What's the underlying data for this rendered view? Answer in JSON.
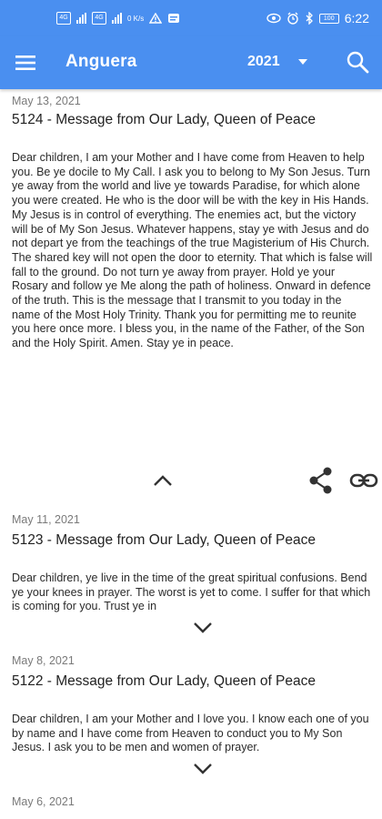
{
  "status_bar": {
    "sim1": "4G",
    "sim2": "4G",
    "net_speed": "0 K/s",
    "battery": "100",
    "time": "6:22"
  },
  "app_bar": {
    "title": "Anguera",
    "year": "2021",
    "menu_icon": "hamburger-menu-icon",
    "dropdown_icon": "triangle-down-icon",
    "search_icon": "search-icon"
  },
  "posts": [
    {
      "date": "May 13, 2021",
      "title": "5124 - Message from Our Lady, Queen of Peace",
      "body": "Dear children, I am your Mother and I have come from Heaven to help you. Be ye docile to My Call. I ask you to belong to My Son Jesus. Turn ye away from the world and live ye towards Paradise, for which alone you were created. He who is the door will be with the key in His Hands. My Jesus is in control of everything. The enemies act, but the victory will be of My Son Jesus. Whatever happens, stay ye with Jesus and do not depart ye from the teachings of the true Magisterium of His Church. The shared key will not open the door to eternity. That which is false will fall to the ground. Do not turn ye away from prayer. Hold ye your Rosary and follow ye Me along the path of holiness. Onward in defence of the truth. This is the message that I transmit to you today in the name of the Most Holy Trinity. Thank you for permitting me to reunite you here once more. I bless you, in the name of the Father, of the Son and the Holy Spirit. Amen. Stay ye in peace."
    },
    {
      "date": "May 11, 2021",
      "title": "5123 - Message from Our Lady, Queen of Peace",
      "excerpt": "Dear children, ye live in the time of the great spiritual confusions. Bend ye your knees in prayer. The worst is yet to come. I suffer for that which is coming for you. Trust ye in"
    },
    {
      "date": "May 8, 2021",
      "title": "5122 - Message from Our Lady, Queen of Peace",
      "excerpt": "Dear children, I am your Mother and I love you. I know each one of you by name and I have come from Heaven to conduct you to My Son Jesus. I ask you to be men and women of prayer."
    },
    {
      "date": "May 6, 2021"
    }
  ]
}
